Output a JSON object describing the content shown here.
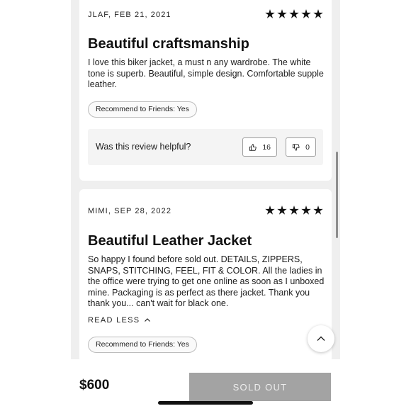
{
  "reviews": [
    {
      "author_date": "JLAF, FEB 21, 2021",
      "rating": 5,
      "title": "Beautiful craftsmanship",
      "body": "I love this biker jacket, a must n any wardrobe. The white tone is superb. Beautiful, simple design. Comfortable supple leather.",
      "recommend": "Recommend to Friends: Yes",
      "helpful_prompt": "Was this review helpful?",
      "helpful_yes": "16",
      "helpful_no": "0"
    },
    {
      "author_date": "MIMI, SEP 28, 2022",
      "rating": 5,
      "title": "Beautiful Leather Jacket",
      "body": "So happy I found before sold out. DETAILS, ZIPPERS, SNAPS, STITCHING, FEEL, FIT & COLOR. All the ladies in the office were trying to get one online as soon as I unboxed mine. Packaging is as perfect as there jacket. Thank you thank you... can't wait for black one.",
      "read_less": "READ LESS",
      "recommend": "Recommend to Friends: Yes"
    }
  ],
  "footer": {
    "price": "$600",
    "button": "SOLD OUT"
  },
  "icons": {
    "star": "star-icon",
    "thumbs_up": "thumbs-up-icon",
    "thumbs_down": "thumbs-down-icon",
    "chevron_up": "chevron-up-icon"
  },
  "colors": {
    "sold_out_bg": "#a3a3a3",
    "page_bg": "#efefef"
  }
}
